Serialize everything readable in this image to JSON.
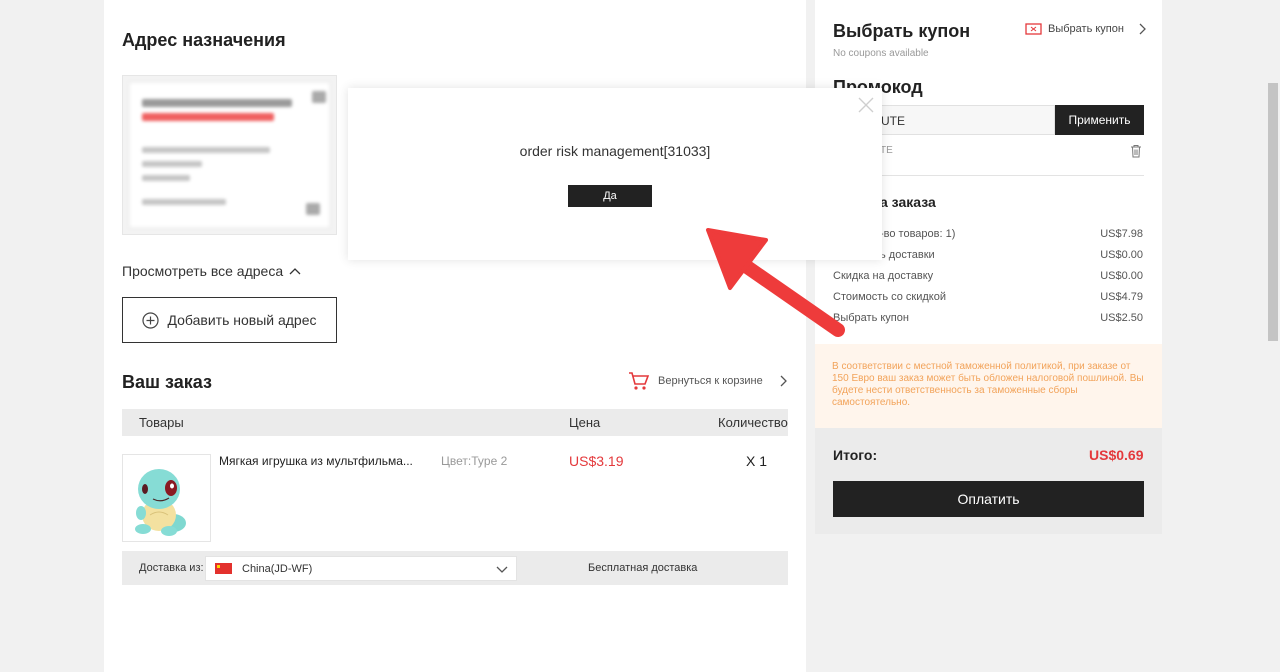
{
  "left": {
    "address_title": "Адрес назначения",
    "view_all": "Просмотреть все адреса",
    "add_address": "Добавить новый адрес",
    "order_title": "Ваш заказ",
    "back_to_cart": "Вернуться к корзине",
    "columns": [
      "Товары",
      "Цена",
      "Количество"
    ],
    "product": {
      "name": "Мягкая игрушка из мультфильма...",
      "color": "Цвет:Type 2",
      "price": "US$3.19",
      "qty": "X 1"
    },
    "shipping": {
      "from_label": "Доставка из:",
      "origin": "China(JD-WF)",
      "method": "Бесплатная доставка"
    }
  },
  "right": {
    "coupon_title": "Выбрать купон",
    "coupon_link": "Выбрать купон",
    "no_coupons": "No coupons available",
    "promo_title": "Промокод",
    "promo_value": "UTE",
    "promo_apply": "Применить",
    "promo_applied": "TE",
    "summary_title": "а заказа",
    "summary_rows": [
      {
        "label": "-во товаров: 1)",
        "value": "US$7.98"
      },
      {
        "label": "ь доставки",
        "value": "US$0.00"
      },
      {
        "label": "Скидка на доставку",
        "value": "US$0.00"
      },
      {
        "label": "Стоимость со скидкой",
        "value": "US$4.79"
      },
      {
        "label": "Выбрать купон",
        "value": "US$2.50"
      }
    ],
    "notice": "В соответствии с местной таможенной политикой, при заказе от 150 Евро ваш заказ может быть обложен налоговой пошлиной. Вы будете нести ответственность за таможенные сборы самостоятельно.",
    "total_label": "Итого:",
    "total_value": "US$0.69",
    "pay": "Оплатить"
  },
  "modal": {
    "message": "order risk management[31033]",
    "ok": "Да"
  },
  "colors": {
    "accent_red": "#e4393c",
    "dark_button": "#222222",
    "notice_text": "#f2a35a",
    "notice_bg": "#fff5ec",
    "arrow": "#ee3b3b"
  }
}
